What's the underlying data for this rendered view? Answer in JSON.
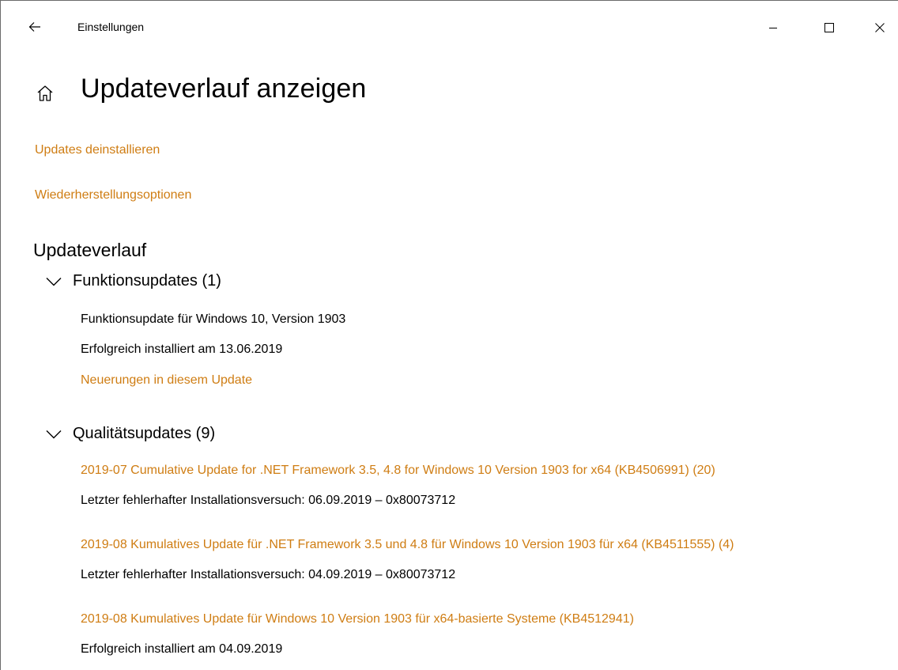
{
  "titlebar": {
    "app_title": "Einstellungen"
  },
  "header": {
    "title": "Updateverlauf anzeigen"
  },
  "links": {
    "uninstall": "Updates deinstallieren",
    "recovery": "Wiederherstellungsoptionen"
  },
  "history": {
    "heading": "Updateverlauf",
    "feature_group": {
      "label": "Funktionsupdates (1)",
      "items": [
        {
          "name": "Funktionsupdate für Windows 10, Version 1903",
          "status": "Erfolgreich installiert am 13.06.2019",
          "link": "Neuerungen in diesem Update"
        }
      ]
    },
    "quality_group": {
      "label": "Qualitätsupdates (9)",
      "items": [
        {
          "name": "2019-07 Cumulative Update for .NET Framework 3.5, 4.8 for Windows 10 Version 1903 for x64 (KB4506991) (20)",
          "status": "Letzter fehlerhafter Installationsversuch: 06.09.2019 – 0x80073712"
        },
        {
          "name": "2019-08 Kumulatives Update für .NET Framework 3.5 und 4.8 für Windows 10 Version 1903 für x64 (KB4511555) (4)",
          "status": "Letzter fehlerhafter Installationsversuch: 04.09.2019 – 0x80073712"
        },
        {
          "name": "2019-08 Kumulatives Update für Windows 10 Version 1903 für x64-basierte Systeme (KB4512941)",
          "status": "Erfolgreich installiert am 04.09.2019"
        }
      ]
    }
  },
  "colors": {
    "accent": "#cf7d13"
  },
  "icons": {
    "back": "arrow-left-icon",
    "minimize": "minimize-icon",
    "maximize": "maximize-icon",
    "close": "close-icon",
    "home": "home-icon",
    "chevron": "chevron-down-icon"
  }
}
